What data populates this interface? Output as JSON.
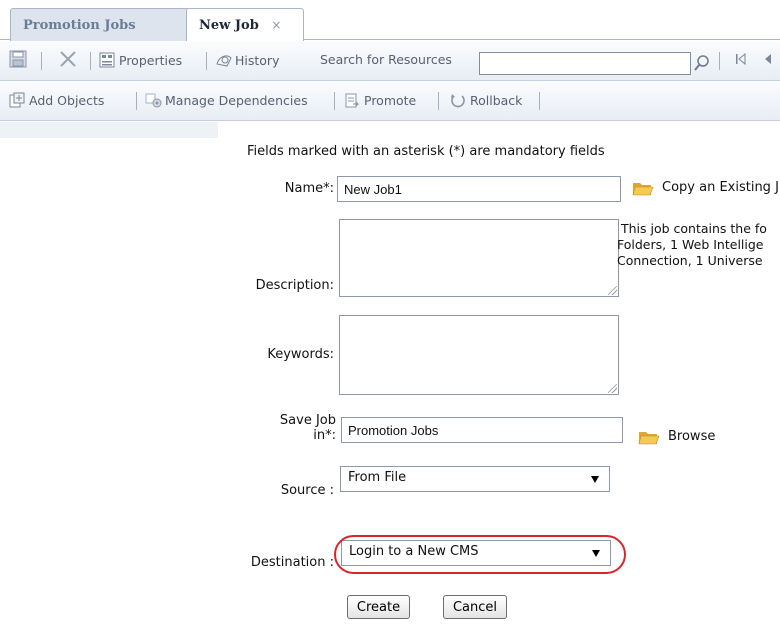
{
  "tabs": [
    {
      "label": "Promotion Jobs",
      "active": false
    },
    {
      "label": "New Job",
      "active": true,
      "close": "×"
    }
  ],
  "toolbar1": {
    "properties_label": "Properties",
    "history_label": "History",
    "search_label": "Search for Resources",
    "search_value": ""
  },
  "toolbar2": {
    "add_objects_label": "Add Objects",
    "manage_dependencies_label": "Manage Dependencies",
    "promote_label": "Promote",
    "rollback_label": "Rollback"
  },
  "form": {
    "mandatory_note": "Fields marked with an asterisk (*) are mandatory fields",
    "name_label": "Name*:",
    "name_value": "New Job1",
    "copy_existing_label": "Copy an Existing J",
    "description_label": "Description:",
    "info_text": " This job contains the fo\nFolders, 1 Web Intellige\nConnection, 1 Universe",
    "keywords_label": "Keywords:",
    "save_job_label_line1": "Save Job",
    "save_job_label_line2": "in*:",
    "save_job_value": "Promotion Jobs",
    "browse_label": "Browse",
    "source_label": "Source :",
    "source_value": "From File",
    "destination_label": "Destination :",
    "destination_value": "Login to a New CMS",
    "create_label": "Create",
    "cancel_label": "Cancel"
  },
  "colors": {
    "highlight_ring": "#d9262a",
    "folder": "#f2c04a",
    "toolbar_bg": "#e8edf4"
  }
}
